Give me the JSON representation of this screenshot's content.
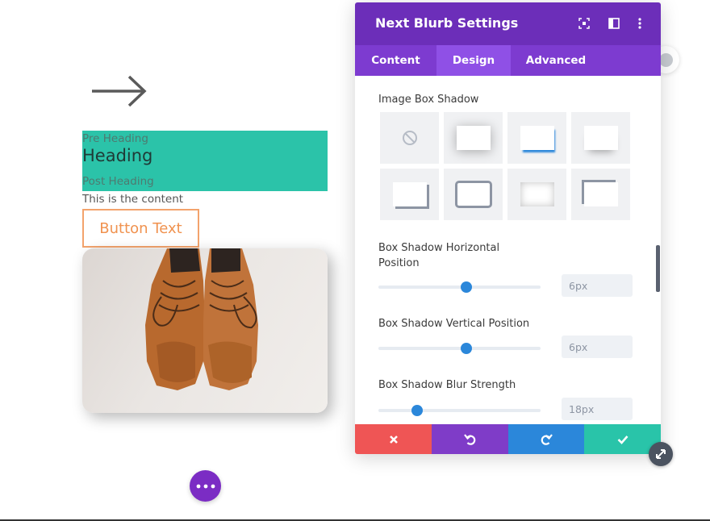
{
  "canvas": {
    "arrow_icon": "arrow-right",
    "blurb": {
      "pre_heading": "Pre Heading",
      "heading": "Heading",
      "post_heading": "Post Heading",
      "content": "This is the content",
      "button_text": "Button Text"
    },
    "image_description_icon": "shoes-image",
    "fab_icon": "more-dots"
  },
  "panel": {
    "title": "Next Blurb Settings",
    "header_icons": [
      "focus-icon",
      "sidebar-icon",
      "kebab-menu-icon"
    ],
    "tabs": [
      {
        "label": "Content",
        "active": false
      },
      {
        "label": "Design",
        "active": true
      },
      {
        "label": "Advanced",
        "active": false
      }
    ],
    "image_box_shadow": {
      "label": "Image Box Shadow",
      "presets": [
        "none",
        "preset-1",
        "preset-2",
        "preset-3",
        "preset-4",
        "preset-5",
        "preset-6",
        "preset-7"
      ]
    },
    "settings": [
      {
        "label": "Box Shadow Horizontal Position",
        "value": "6px",
        "slider_fraction": 0.54
      },
      {
        "label": "Box Shadow Vertical Position",
        "value": "6px",
        "slider_fraction": 0.54
      },
      {
        "label": "Box Shadow Blur Strength",
        "value": "18px",
        "slider_fraction": 0.24
      }
    ],
    "footer": [
      {
        "icon": "close-icon",
        "color": "#ef5555"
      },
      {
        "icon": "undo-icon",
        "color": "#7f3cc8"
      },
      {
        "icon": "redo-icon",
        "color": "#2b87da"
      },
      {
        "icon": "check-icon",
        "color": "#29c4a9"
      }
    ]
  },
  "colors": {
    "header": "#6c2eb9",
    "tabs": "#7d3bd0",
    "tab_active": "#8f50e6",
    "accent_blue": "#2b87da",
    "teal": "#2bc3a9",
    "button_orange": "#f0924f"
  }
}
